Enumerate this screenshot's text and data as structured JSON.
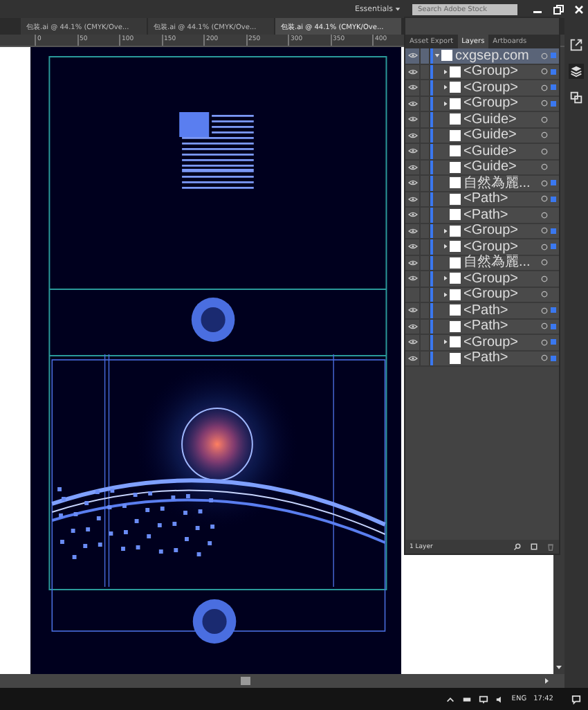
{
  "app_bar": {
    "workspace": "Essentials",
    "search": {
      "placeholder": "Search Adobe Stock"
    }
  },
  "document_tabs": [
    {
      "label": "包装.ai @ 44.1% (CMYK/Ove...",
      "selected": false
    },
    {
      "label": "包装.ai @ 44.1% (CMYK/Ove...",
      "selected": false
    },
    {
      "label": "包装.ai @ 44.1% (CMYK/Ove...",
      "selected": true
    }
  ],
  "ruler": [
    "0",
    "50",
    "100",
    "150",
    "200",
    "250",
    "300",
    "350",
    "400"
  ],
  "layers_panel": {
    "tabs": [
      {
        "label": "Asset Export",
        "selected": false
      },
      {
        "label": "Layers",
        "selected": true
      },
      {
        "label": "Artboards",
        "selected": false
      }
    ],
    "rows": [
      {
        "name": "cxgsep.com",
        "visible": true,
        "expanded": true,
        "selected": true,
        "children": [
          {
            "name": "<Group>",
            "visible": true,
            "expanded": false,
            "selected": true
          },
          {
            "name": "<Group>",
            "visible": true,
            "expanded": false,
            "selected": true
          },
          {
            "name": "<Group>",
            "visible": true,
            "expanded": false,
            "selected": true
          },
          {
            "name": "<Guide>",
            "visible": true,
            "selected": false
          },
          {
            "name": "<Guide>",
            "visible": true,
            "selected": false
          },
          {
            "name": "<Guide>",
            "visible": true,
            "selected": false
          },
          {
            "name": "<Guide>",
            "visible": true,
            "selected": false
          },
          {
            "name": "自然為麗...",
            "visible": true,
            "selected": true
          },
          {
            "name": "<Path>",
            "visible": true,
            "selected": true
          },
          {
            "name": "<Path>",
            "visible": true,
            "selected": false
          },
          {
            "name": "<Group>",
            "visible": true,
            "expanded": false,
            "selected": true
          },
          {
            "name": "<Group>",
            "visible": true,
            "expanded": false,
            "selected": true
          },
          {
            "name": "自然為麗...",
            "visible": true,
            "selected": false
          },
          {
            "name": "<Group>",
            "visible": true,
            "expanded": false,
            "selected": false
          },
          {
            "name": "<Group>",
            "visible": false,
            "expanded": false,
            "selected": false
          },
          {
            "name": "<Path>",
            "visible": true,
            "selected": true
          },
          {
            "name": "<Path>",
            "visible": true,
            "selected": true
          },
          {
            "name": "<Group>",
            "visible": true,
            "expanded": false,
            "selected": true
          },
          {
            "name": "<Path>",
            "visible": true,
            "selected": true
          }
        ]
      }
    ],
    "footer": "1 Layer"
  },
  "taskbar": {
    "language": "ENG",
    "time": "17:42"
  }
}
